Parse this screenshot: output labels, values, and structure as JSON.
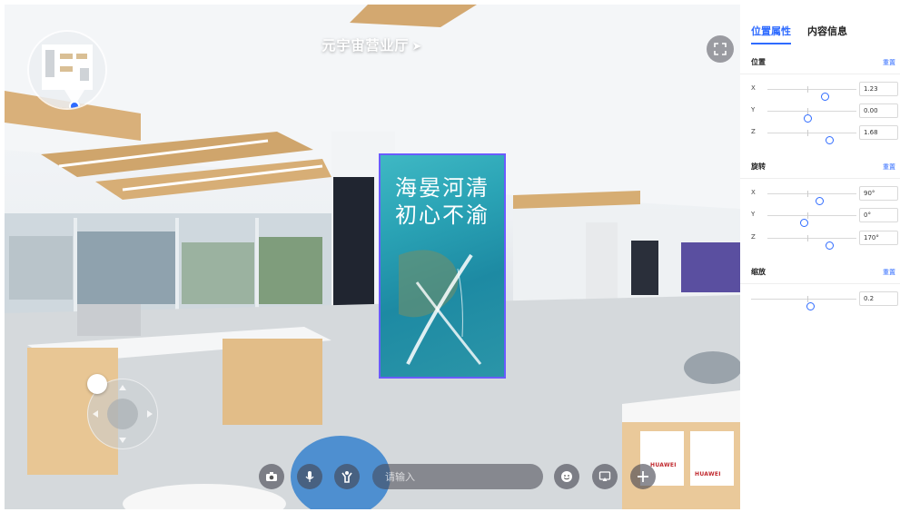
{
  "scene": {
    "title": "元宇宙营业厅",
    "poster": {
      "line1": "海晏河清",
      "line2": "初心不渝"
    },
    "brand_labels": [
      "HUAWEI",
      "HUAWEI"
    ]
  },
  "toolbar": {
    "input_placeholder": "请输入",
    "buttons": [
      "camera",
      "microphone",
      "avatar",
      "emoji",
      "screen-share",
      "add"
    ]
  },
  "panel": {
    "tabs": [
      {
        "label": "位置属性",
        "active": true
      },
      {
        "label": "内容信息",
        "active": false
      }
    ],
    "reset_label": "重置",
    "sections": [
      {
        "title": "位置",
        "rows": [
          {
            "axis": "X",
            "value": "1.23",
            "slider": 0.64
          },
          {
            "axis": "Y",
            "value": "0.00",
            "slider": 0.45
          },
          {
            "axis": "Z",
            "value": "1.68",
            "slider": 0.69
          }
        ]
      },
      {
        "title": "旋转",
        "rows": [
          {
            "axis": "X",
            "value": "90°",
            "slider": 0.58
          },
          {
            "axis": "Y",
            "value": "0°",
            "slider": 0.41
          },
          {
            "axis": "Z",
            "value": "170°",
            "slider": 0.69
          }
        ]
      },
      {
        "title": "缩放",
        "rows": [
          {
            "axis": "",
            "value": "0.2",
            "slider": 0.56
          }
        ]
      }
    ]
  },
  "colors": {
    "accent": "#2f6bff",
    "poster_border": "#6a5cff",
    "brand_red": "#c0282d"
  }
}
